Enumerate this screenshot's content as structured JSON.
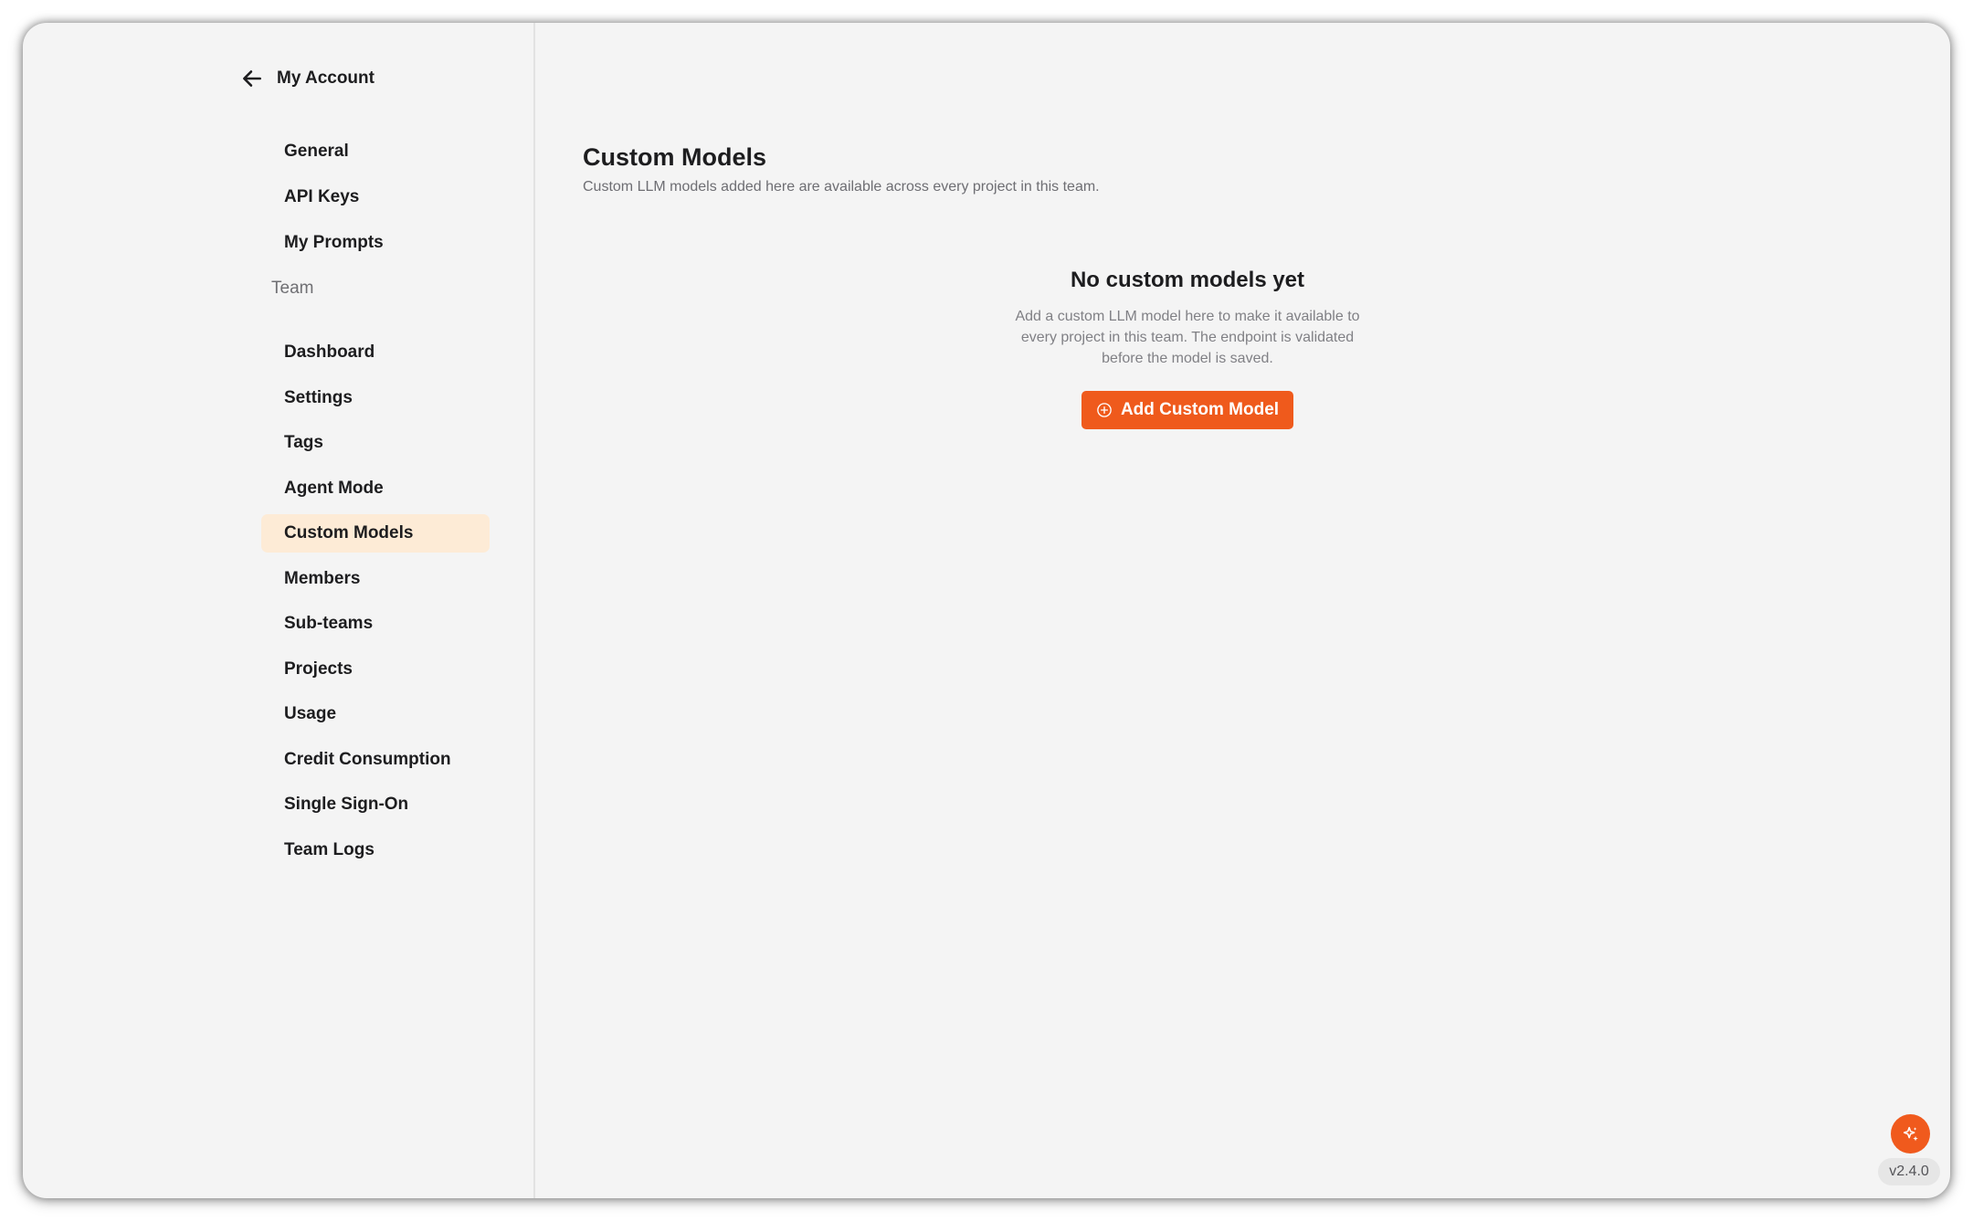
{
  "header": {
    "back_label": "My Account"
  },
  "sidebar": {
    "account_items": [
      {
        "label": "General"
      },
      {
        "label": "API Keys"
      },
      {
        "label": "My Prompts"
      }
    ],
    "team_section": "Team",
    "team_items": [
      {
        "label": "Dashboard"
      },
      {
        "label": "Settings"
      },
      {
        "label": "Tags"
      },
      {
        "label": "Agent Mode"
      },
      {
        "label": "Custom Models",
        "active": true
      },
      {
        "label": "Members"
      },
      {
        "label": "Sub-teams"
      },
      {
        "label": "Projects"
      },
      {
        "label": "Usage"
      },
      {
        "label": "Credit Consumption"
      },
      {
        "label": "Single Sign-On"
      },
      {
        "label": "Team Logs"
      }
    ]
  },
  "main": {
    "title": "Custom Models",
    "subtitle": "Custom LLM models added here are available across every project in this team.",
    "empty_state": {
      "title": "No custom models yet",
      "description": "Add a custom LLM model here to make it available to every project in this team. The endpoint is validated before the model is saved.",
      "button_label": "Add Custom Model",
      "button_icon": "plus-circle-icon"
    }
  },
  "footer": {
    "assistant_icon": "sparkle-icon",
    "version": "v2.4.0"
  },
  "colors": {
    "accent": "#ef5a1c",
    "active_nav_bg": "#fdebd6",
    "background": "#f4f4f4"
  }
}
